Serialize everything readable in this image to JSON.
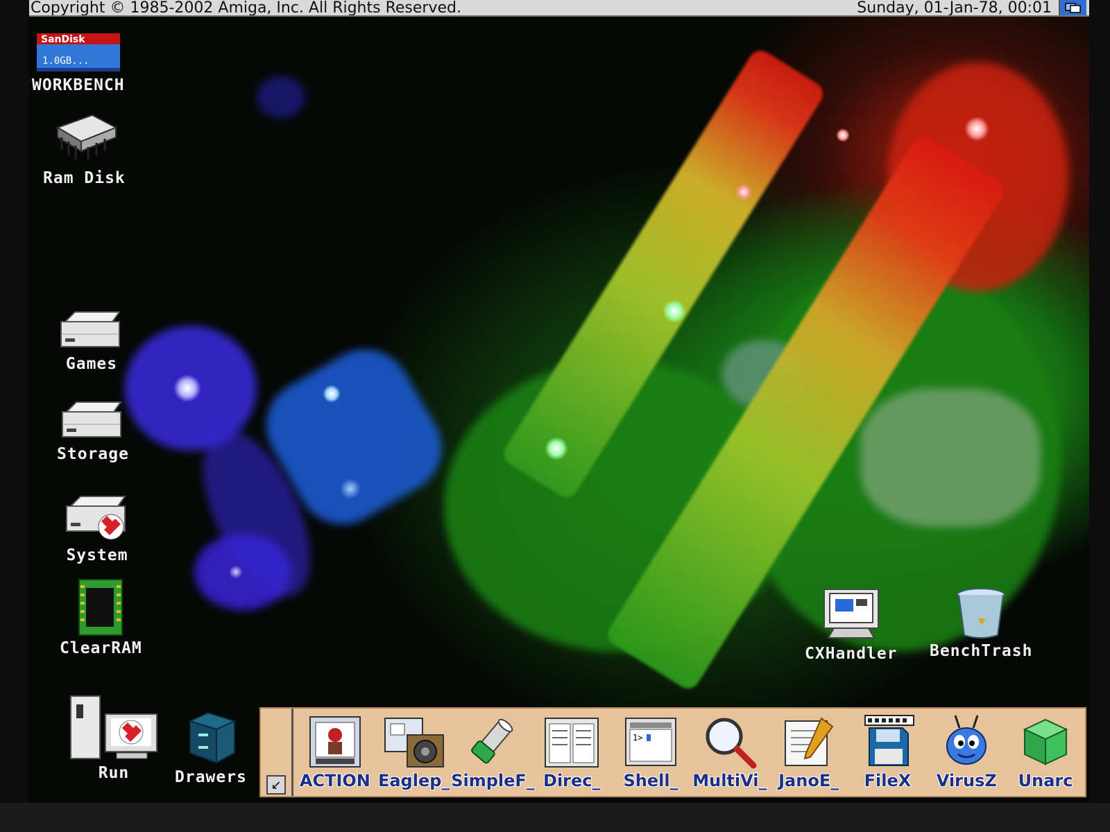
{
  "titlebar": {
    "copyright": "Copyright © 1985-2002 Amiga, Inc. All Rights Reserved.",
    "clock": "Sunday, 01-Jan-78, 00:01"
  },
  "desktop_icons": [
    {
      "label": "WORKBENCH",
      "icon": "sandisk-drive-icon"
    },
    {
      "label": "Ram Disk",
      "icon": "ram-chip-icon"
    },
    {
      "label": "Games",
      "icon": "drawer-drive-icon"
    },
    {
      "label": "Storage",
      "icon": "drawer-drive-icon"
    },
    {
      "label": "System",
      "icon": "system-drive-icon"
    },
    {
      "label": "ClearRAM",
      "icon": "memory-board-icon"
    },
    {
      "label": "CXHandler",
      "icon": "monitor-icon"
    },
    {
      "label": "BenchTrash",
      "icon": "trash-can-icon"
    },
    {
      "label": "Run",
      "icon": "computer-tower-icon"
    },
    {
      "label": "Drawers",
      "icon": "cabinet-icon"
    }
  ],
  "dock": {
    "arrow": "↙",
    "items": [
      {
        "label": "ACTION",
        "icon": "action-icon"
      },
      {
        "label": "Eaglep_",
        "icon": "eagleplayer-icon"
      },
      {
        "label": "SimpleF_",
        "icon": "flashlight-icon"
      },
      {
        "label": "Direc_",
        "icon": "directory-icon"
      },
      {
        "label": "Shell_",
        "icon": "shell-icon"
      },
      {
        "label": "MultiVi_",
        "icon": "magnifier-icon"
      },
      {
        "label": "JanoE_",
        "icon": "notepad-icon"
      },
      {
        "label": "FileX",
        "icon": "disk-file-icon"
      },
      {
        "label": "VirusZ",
        "icon": "bug-icon"
      },
      {
        "label": "Unarc",
        "icon": "green-cube-icon"
      }
    ]
  },
  "colors": {
    "titlebar_bg": "#d9d9d9",
    "dock_bg": "#e6c39a",
    "dock_label": "#1b2f86",
    "icon_label": "#f2f2f2"
  }
}
